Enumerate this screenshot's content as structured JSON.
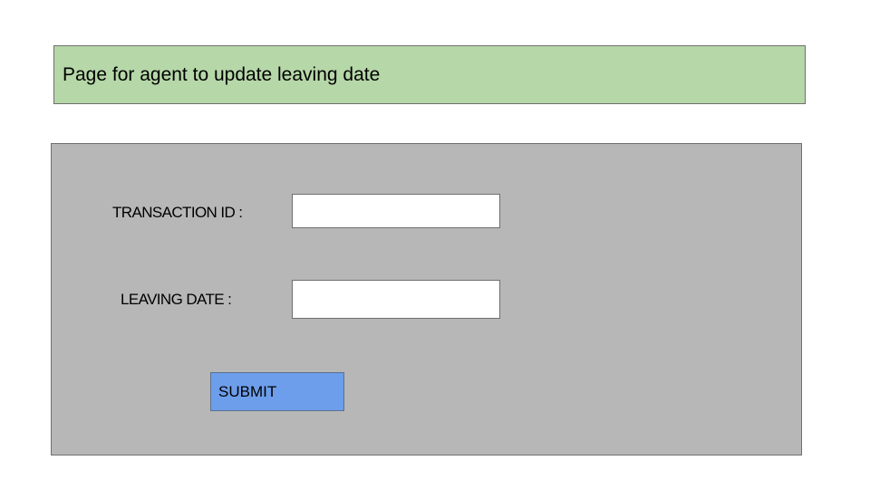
{
  "header": {
    "title": "Page for agent to update leaving date"
  },
  "form": {
    "transaction_id_label": "TRANSACTION ID :",
    "transaction_id_value": "",
    "leaving_date_label": "LEAVING DATE :",
    "leaving_date_value": "",
    "submit_label": "SUBMIT"
  },
  "colors": {
    "header_background": "#b6d7a8",
    "panel_background": "#b7b7b7",
    "submit_background": "#6d9eeb"
  }
}
